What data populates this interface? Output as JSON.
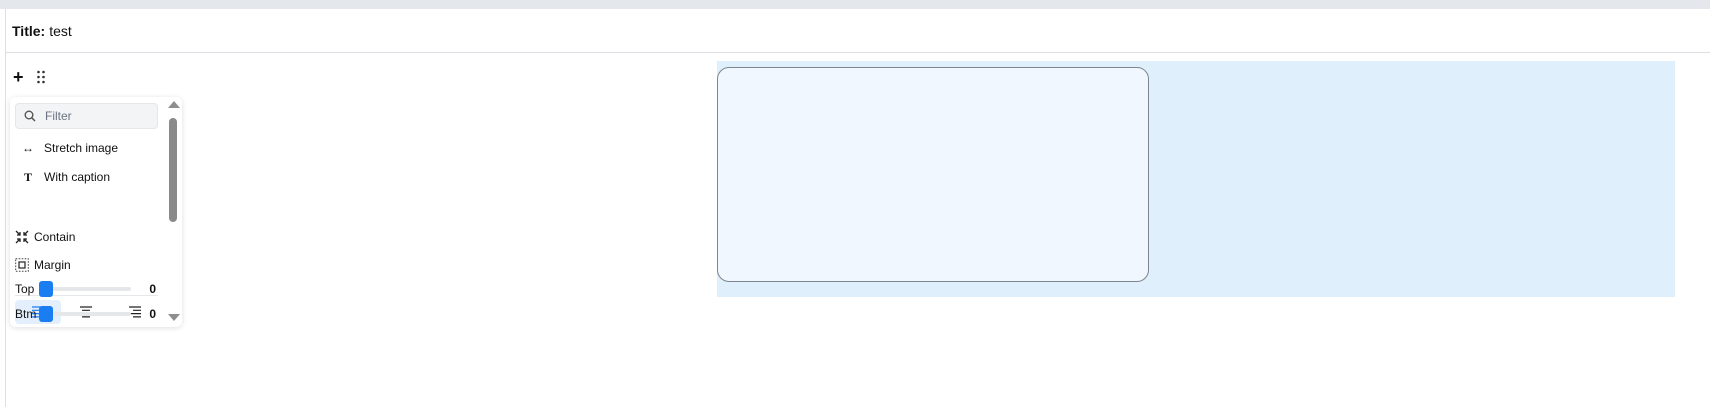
{
  "header": {
    "title_label": "Title:",
    "title_value": "test"
  },
  "toolbar": {
    "add_icon": "plus-icon",
    "drag_icon": "drag-handle-icon"
  },
  "panel": {
    "filter_placeholder": "Filter",
    "items": [
      {
        "icon": "↔",
        "label": "Stretch image"
      },
      {
        "icon": "T",
        "label": "With caption"
      }
    ],
    "alignment": {
      "options": [
        "left",
        "center",
        "right"
      ],
      "selected": "left"
    },
    "fit_label": "Contain",
    "margin_label": "Margin",
    "sliders": [
      {
        "label": "Top",
        "value": "0"
      },
      {
        "label": "Btm",
        "value": "0"
      }
    ]
  },
  "colors": {
    "accent": "#1a7ef2",
    "block_bg": "#dfeffb",
    "frame_bg": "#f0f7fe"
  }
}
